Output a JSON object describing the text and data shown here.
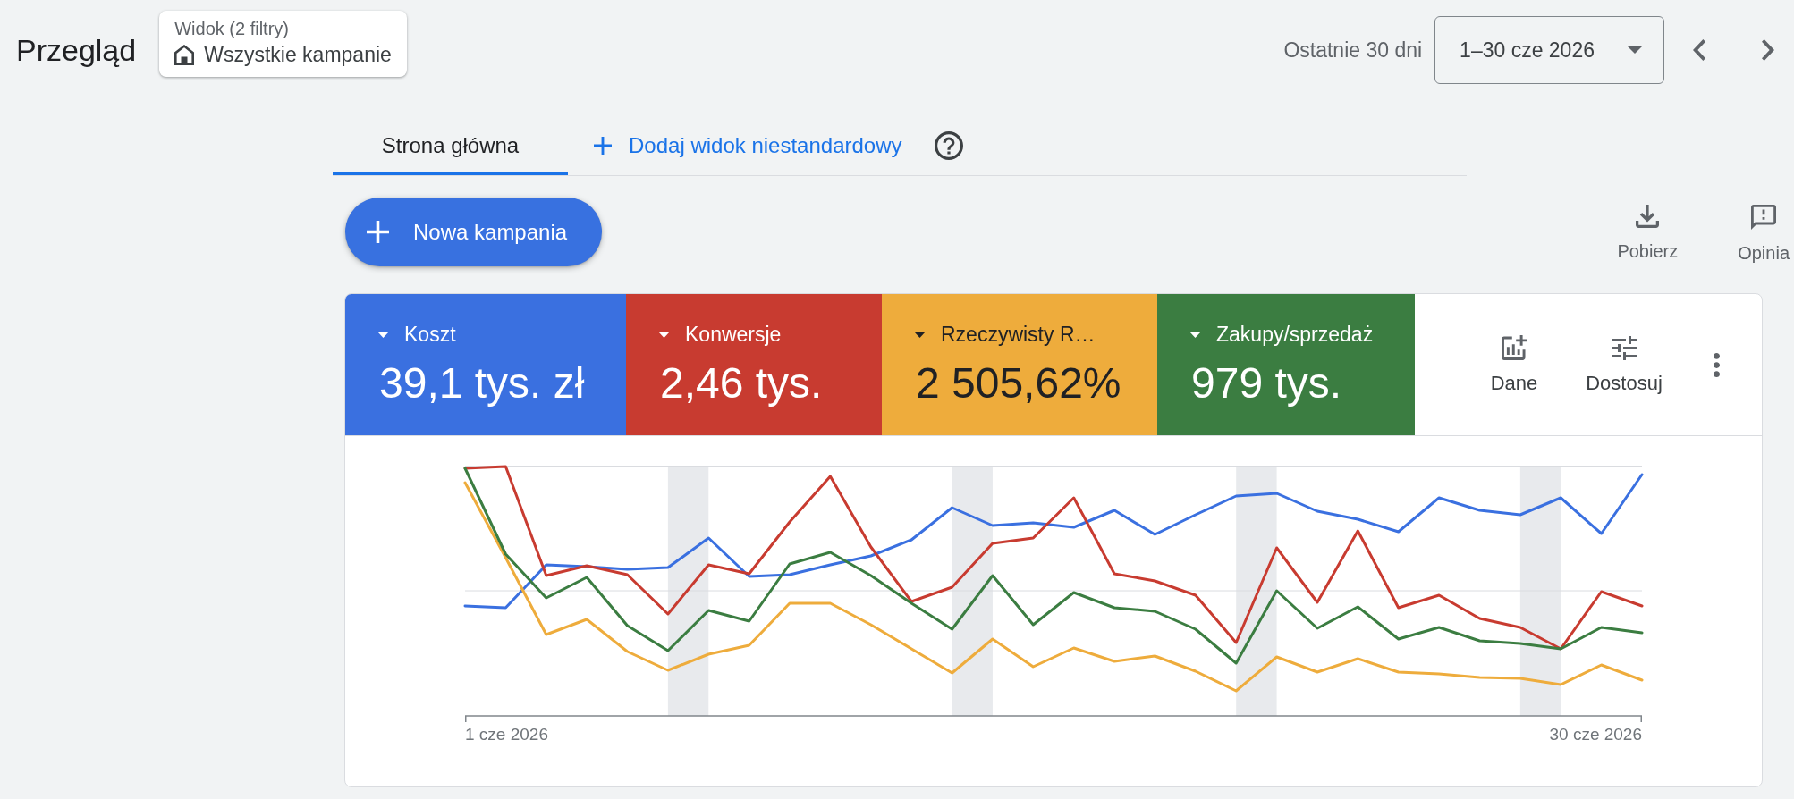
{
  "header": {
    "title": "Przegląd",
    "view": {
      "caption": "Widok (2 filtry)",
      "name": "Wszystkie kampanie"
    },
    "date_range": {
      "caption": "Ostatnie 30 dni",
      "value": "1–30 cze 2026"
    }
  },
  "tabs": [
    {
      "label": "Strona główna",
      "selected": true
    }
  ],
  "add_view": {
    "label": "Dodaj widok niestandardowy"
  },
  "new_campaign": {
    "label": "Nowa kampania"
  },
  "actions": [
    {
      "label": "Pobierz",
      "kind": "download"
    },
    {
      "label": "Opinia",
      "kind": "feedback"
    }
  ],
  "metrics": [
    {
      "label": "Koszt",
      "value": "39,1 tys. zł",
      "color": "#3a70e0",
      "selected": true
    },
    {
      "label": "Konwersje",
      "value": "2,46 tys.",
      "color": "#c83b30",
      "selected": true
    },
    {
      "label": "Rzeczywisty R…",
      "value": "2 505,62%",
      "color": "#eeac3c",
      "selected": true
    },
    {
      "label": "Zakupy/sprzedaż",
      "value": "979 tys.",
      "color": "#3b7d41",
      "selected": true
    }
  ],
  "card_tools": [
    {
      "label": "Dane",
      "kind": "data"
    },
    {
      "label": "Dostosuj",
      "kind": "adjust"
    }
  ],
  "chart": {
    "start_label": "1 cze 2026",
    "end_label": "30 cze 2026"
  }
}
